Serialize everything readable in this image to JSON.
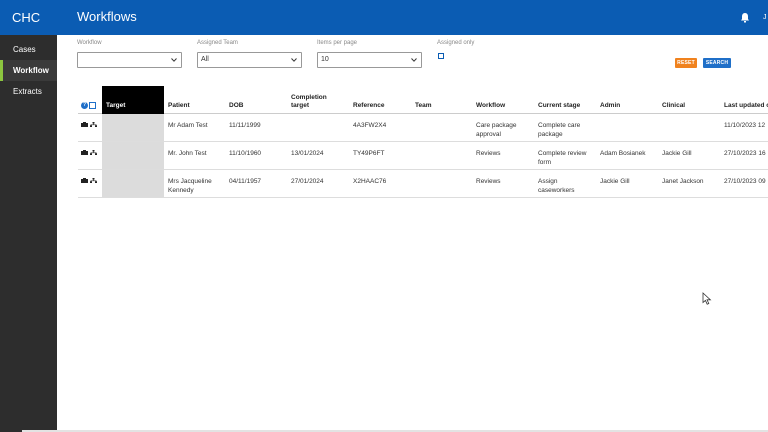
{
  "sidebar": {
    "brand": "CHC",
    "items": [
      {
        "label": "Cases"
      },
      {
        "label": "Workflow"
      },
      {
        "label": "Extracts"
      }
    ]
  },
  "header": {
    "title": "Workflows",
    "user_initial": "J"
  },
  "filters": {
    "workflow_label": "Workflow",
    "workflow_value": "",
    "team_label": "Assigned Team",
    "team_value": "All",
    "per_page_label": "Items per page",
    "per_page_value": "10",
    "assigned_only_label": "Assigned only",
    "reset_label": "RESET",
    "search_label": "SEARCH"
  },
  "table": {
    "headers": {
      "target": "Target",
      "patient": "Patient",
      "dob": "DOB",
      "completion": "Completion target",
      "reference": "Reference",
      "team": "Team",
      "workflow": "Workflow",
      "stage": "Current stage",
      "admin": "Admin",
      "clinical": "Clinical",
      "updated": "Last updated o"
    },
    "rows": [
      {
        "patient": "Mr Adam Test",
        "dob": "11/11/1999",
        "completion": "",
        "reference": "4A3FW2X4",
        "team": "",
        "workflow": "Care package approval",
        "stage": "Complete care package",
        "admin": "",
        "clinical": "",
        "updated": "11/10/2023 12"
      },
      {
        "patient": "Mr. John Test",
        "dob": "11/10/1960",
        "completion": "13/01/2024",
        "reference": "TY49P6FT",
        "team": "",
        "workflow": "Reviews",
        "stage": "Complete review form",
        "admin": "Adam Bosianek",
        "clinical": "Jackie Gill",
        "updated": "27/10/2023 16"
      },
      {
        "patient": "Mrs Jacqueline Kennedy",
        "dob": "04/11/1957",
        "completion": "27/01/2024",
        "reference": "X2HAAC76",
        "team": "",
        "workflow": "Reviews",
        "stage": "Assign caseworkers",
        "admin": "Jackie Gill",
        "clinical": "Janet Jackson",
        "updated": "27/10/2023 09"
      }
    ]
  },
  "colors": {
    "brand_blue": "#0b5cb3",
    "active_accent": "#8cc63f",
    "reset_orange": "#f0821e"
  }
}
